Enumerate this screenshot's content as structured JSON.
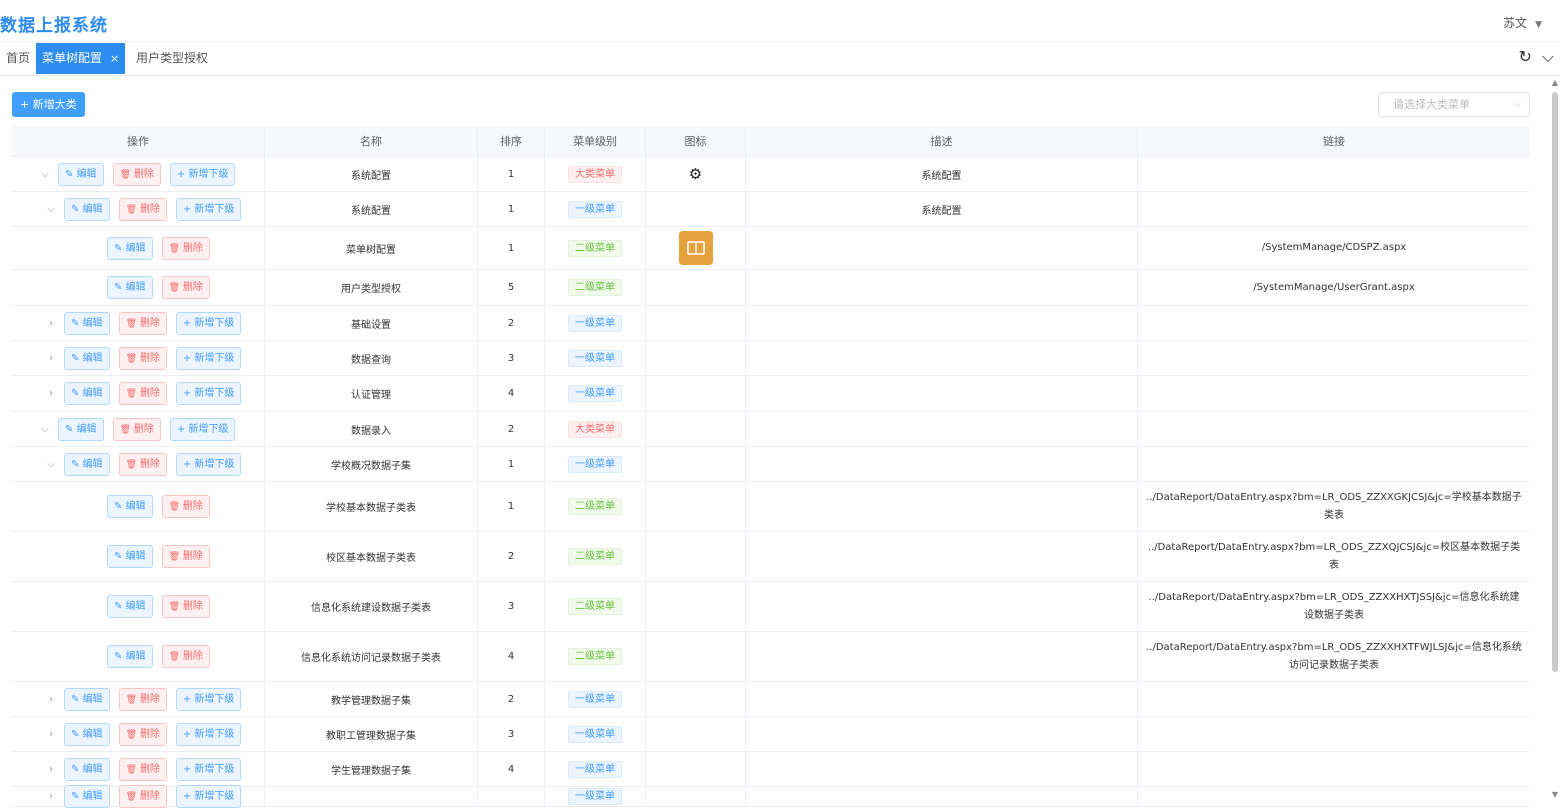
{
  "app": {
    "title": "数据上报系统",
    "user": "苏文"
  },
  "tabs": [
    {
      "label": "首页",
      "active": false
    },
    {
      "label": "菜单树配置",
      "active": true
    },
    {
      "label": "用户类型授权",
      "active": false
    }
  ],
  "toolbar": {
    "add_label": "+ 新增大类",
    "select_placeholder": "请选择大类菜单"
  },
  "table": {
    "columns": [
      "操作",
      "名称",
      "排序",
      "菜单级别",
      "图标",
      "描述",
      "链接"
    ],
    "buttons": {
      "edit": "编辑",
      "delete": "删除",
      "add_child": "新增下级"
    },
    "rows": [
      {
        "name": "系统配置",
        "sort": "1",
        "level": "大类菜单",
        "level_color": "red",
        "icon": "gear",
        "desc": "系统配置",
        "link": "",
        "toggle": "expanded",
        "indent": 0,
        "has_add": true
      },
      {
        "name": "系统配置",
        "sort": "1",
        "level": "一级菜单",
        "level_color": "blue",
        "icon": "",
        "desc": "系统配置",
        "link": "",
        "toggle": "expanded",
        "indent": 1,
        "has_add": true
      },
      {
        "name": "菜单树配置",
        "sort": "1",
        "level": "二级菜单",
        "level_color": "green",
        "icon": "book",
        "desc": "",
        "link": "/SystemManage/CDSPZ.aspx",
        "toggle": "none",
        "indent": 2,
        "has_add": false
      },
      {
        "name": "用户类型授权",
        "sort": "5",
        "level": "二级菜单",
        "level_color": "green",
        "icon": "",
        "desc": "",
        "link": "/SystemManage/UserGrant.aspx",
        "toggle": "none",
        "indent": 2,
        "has_add": false
      },
      {
        "name": "基础设置",
        "sort": "2",
        "level": "一级菜单",
        "level_color": "blue",
        "icon": "",
        "desc": "",
        "link": "",
        "toggle": "collapsed",
        "indent": 1,
        "has_add": true
      },
      {
        "name": "数据查询",
        "sort": "3",
        "level": "一级菜单",
        "level_color": "blue",
        "icon": "",
        "desc": "",
        "link": "",
        "toggle": "collapsed",
        "indent": 1,
        "has_add": true
      },
      {
        "name": "认证管理",
        "sort": "4",
        "level": "一级菜单",
        "level_color": "blue",
        "icon": "",
        "desc": "",
        "link": "",
        "toggle": "collapsed",
        "indent": 1,
        "has_add": true
      },
      {
        "name": "数据录入",
        "sort": "2",
        "level": "大类菜单",
        "level_color": "red",
        "icon": "",
        "desc": "",
        "link": "",
        "toggle": "expanded",
        "indent": 0,
        "has_add": true
      },
      {
        "name": "学校概况数据子集",
        "sort": "1",
        "level": "一级菜单",
        "level_color": "blue",
        "icon": "",
        "desc": "",
        "link": "",
        "toggle": "expanded",
        "indent": 1,
        "has_add": true
      },
      {
        "name": "学校基本数据子类表",
        "sort": "1",
        "level": "二级菜单",
        "level_color": "green",
        "icon": "",
        "desc": "",
        "link": "../DataReport/DataEntry.aspx?bm=LR_ODS_ZZXXGKJCSJ&jc=学校基本数据子类表",
        "toggle": "none",
        "indent": 2,
        "has_add": false
      },
      {
        "name": "校区基本数据子类表",
        "sort": "2",
        "level": "二级菜单",
        "level_color": "green",
        "icon": "",
        "desc": "",
        "link": "../DataReport/DataEntry.aspx?bm=LR_ODS_ZZXQJCSJ&jc=校区基本数据子类表",
        "toggle": "none",
        "indent": 2,
        "has_add": false
      },
      {
        "name": "信息化系统建设数据子类表",
        "sort": "3",
        "level": "二级菜单",
        "level_color": "green",
        "icon": "",
        "desc": "",
        "link": "../DataReport/DataEntry.aspx?bm=LR_ODS_ZZXXHXTJSSJ&jc=信息化系统建设数据子类表",
        "toggle": "none",
        "indent": 2,
        "has_add": false
      },
      {
        "name": "信息化系统访问记录数据子类表",
        "sort": "4",
        "level": "二级菜单",
        "level_color": "green",
        "icon": "",
        "desc": "",
        "link": "../DataReport/DataEntry.aspx?bm=LR_ODS_ZZXXHXTFWJLSJ&jc=信息化系统访问记录数据子类表",
        "toggle": "none",
        "indent": 2,
        "has_add": false
      },
      {
        "name": "教学管理数据子集",
        "sort": "2",
        "level": "一级菜单",
        "level_color": "blue",
        "icon": "",
        "desc": "",
        "link": "",
        "toggle": "collapsed",
        "indent": 1,
        "has_add": true
      },
      {
        "name": "教职工管理数据子集",
        "sort": "3",
        "level": "一级菜单",
        "level_color": "blue",
        "icon": "",
        "desc": "",
        "link": "",
        "toggle": "collapsed",
        "indent": 1,
        "has_add": true
      },
      {
        "name": "学生管理数据子集",
        "sort": "4",
        "level": "一级菜单",
        "level_color": "blue",
        "icon": "",
        "desc": "",
        "link": "",
        "toggle": "collapsed",
        "indent": 1,
        "has_add": true
      },
      {
        "name": "",
        "sort": "",
        "level": "一级菜单",
        "level_color": "blue",
        "icon": "",
        "desc": "",
        "link": "",
        "toggle": "collapsed",
        "indent": 1,
        "has_add": true
      }
    ]
  }
}
